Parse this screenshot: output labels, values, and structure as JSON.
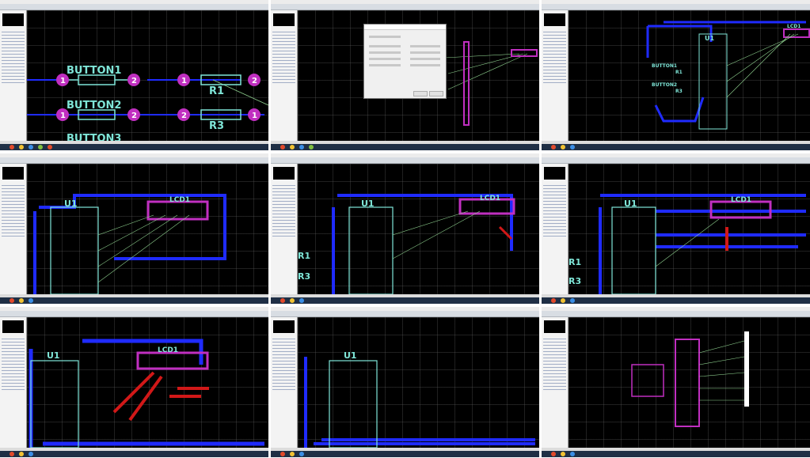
{
  "layout": "3x3 collage of PCB layout editor screenshots",
  "tiles": [
    {
      "id": 1,
      "scene": "zoomed-parts",
      "labels": [
        "BUTTON1",
        "BUTTON2",
        "BUTTON3",
        "R1",
        "R3"
      ],
      "pins": [
        "1",
        "2",
        "1",
        "2",
        "1",
        "2",
        "2",
        "1"
      ]
    },
    {
      "id": 2,
      "scene": "dialog"
    },
    {
      "id": 3,
      "scene": "overview",
      "labels": [
        "U1",
        "LCD1",
        "BUTTON1",
        "BUTTON2",
        "R1",
        "R3"
      ]
    },
    {
      "id": 4,
      "scene": "u1-lcd",
      "labels": [
        "U1",
        "LCD1"
      ]
    },
    {
      "id": 5,
      "scene": "u1-lcd-resistors",
      "labels": [
        "U1",
        "LCD1",
        "R1",
        "R3"
      ]
    },
    {
      "id": 6,
      "scene": "routed",
      "labels": [
        "U1",
        "LCD1",
        "R1",
        "R3"
      ]
    },
    {
      "id": 7,
      "scene": "zoomed-routed",
      "labels": [
        "U1",
        "LCD1"
      ]
    },
    {
      "id": 8,
      "scene": "u1-only",
      "labels": [
        "U1"
      ]
    },
    {
      "id": 9,
      "scene": "ratsnest-overview"
    }
  ],
  "colors": {
    "canvas": "#000000",
    "pad": "#c02fc0",
    "track_blue": "#1f2bff",
    "track_red": "#d11818",
    "silk": "#7fe6d8",
    "ratsnest": "#8fd18f",
    "taskbar": "#1f2f45"
  }
}
